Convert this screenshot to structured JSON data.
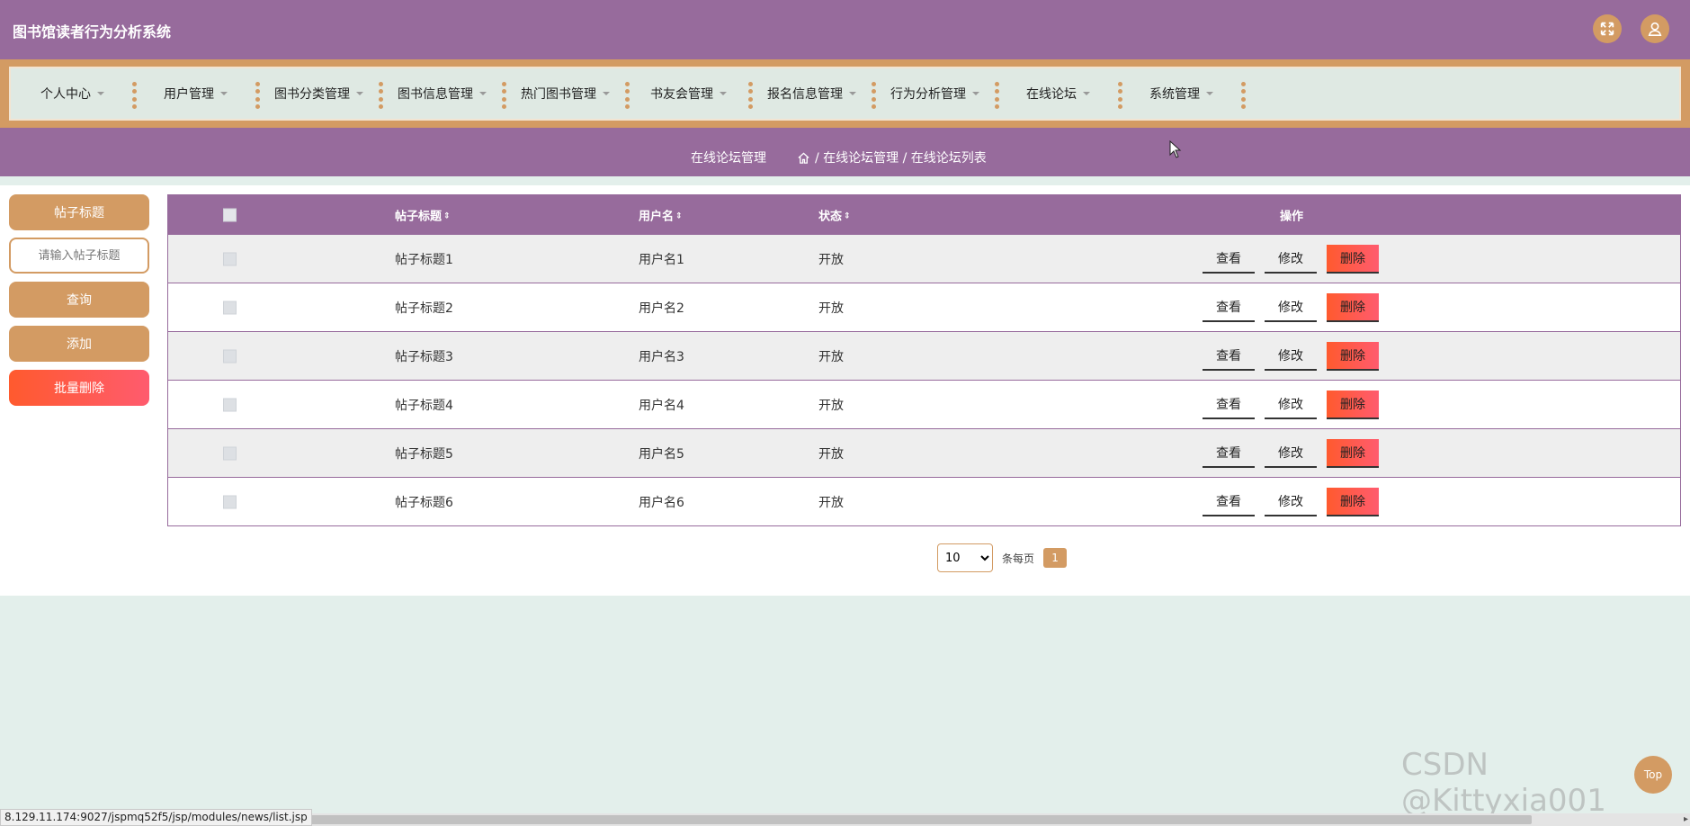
{
  "app": {
    "title": "图书馆读者行为分析系统"
  },
  "header": {
    "expand_icon": "expand-icon",
    "user_icon": "user-icon"
  },
  "nav": {
    "items": [
      {
        "label": "个人中心"
      },
      {
        "label": "用户管理"
      },
      {
        "label": "图书分类管理"
      },
      {
        "label": "图书信息管理"
      },
      {
        "label": "热门图书管理"
      },
      {
        "label": "书友会管理"
      },
      {
        "label": "报名信息管理"
      },
      {
        "label": "行为分析管理"
      },
      {
        "label": "在线论坛"
      },
      {
        "label": "系统管理"
      }
    ]
  },
  "breadcrumb": {
    "page_title": "在线论坛管理",
    "path": "/ 在线论坛管理 / 在线论坛列表"
  },
  "sidebar": {
    "label_button": "帖子标题",
    "search_placeholder": "请输入帖子标题",
    "query_button": "查询",
    "add_button": "添加",
    "batch_delete_button": "批量删除"
  },
  "table": {
    "headers": {
      "title": "帖子标题",
      "username": "用户名",
      "status": "状态",
      "ops": "操作",
      "sort_symbol": "⇕"
    },
    "rows": [
      {
        "title": "帖子标题1",
        "username": "用户名1",
        "status": "开放"
      },
      {
        "title": "帖子标题2",
        "username": "用户名2",
        "status": "开放"
      },
      {
        "title": "帖子标题3",
        "username": "用户名3",
        "status": "开放"
      },
      {
        "title": "帖子标题4",
        "username": "用户名4",
        "status": "开放"
      },
      {
        "title": "帖子标题5",
        "username": "用户名5",
        "status": "开放"
      },
      {
        "title": "帖子标题6",
        "username": "用户名6",
        "status": "开放"
      }
    ],
    "actions": {
      "view": "查看",
      "edit": "修改",
      "delete": "删除"
    }
  },
  "pagination": {
    "page_size": "10",
    "per_page_label": "条每页",
    "current_page": "1"
  },
  "statusbar": {
    "url": "8.129.11.174:9027/jspmq52f5/jsp/modules/news/list.jsp"
  },
  "back_to_top": "Top",
  "watermark": "CSDN @Kittyxia001",
  "colors": {
    "primary": "#976b9c",
    "accent": "#d39b63",
    "danger": "#ff5a2e",
    "background": "#e3efeb"
  }
}
